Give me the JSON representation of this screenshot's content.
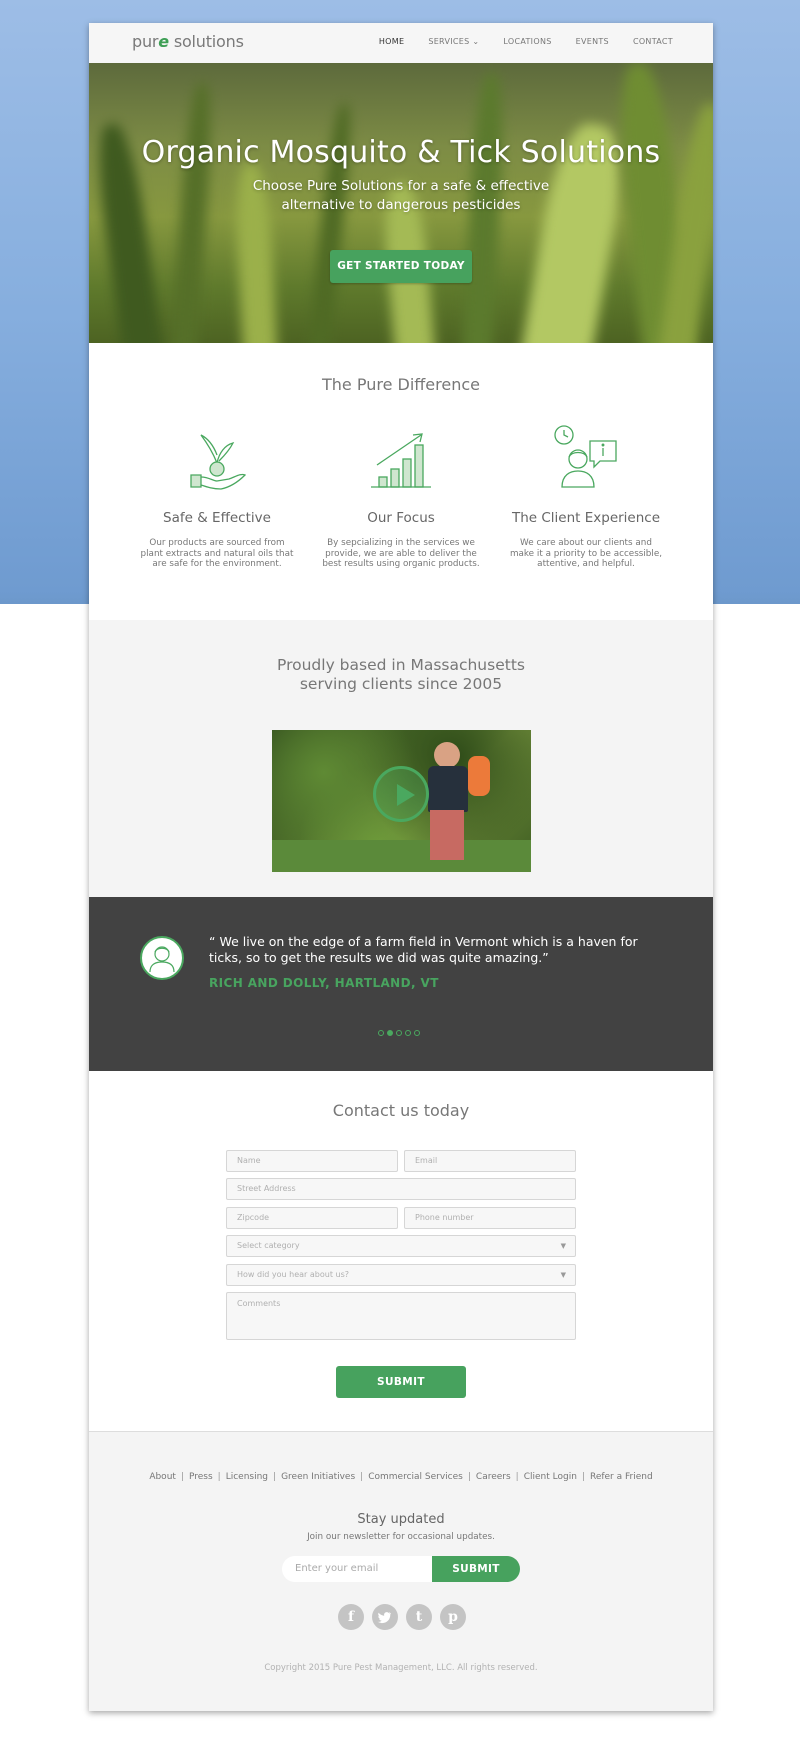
{
  "nav": {
    "logo_main": "pur",
    "logo_accent": "e",
    "logo_rest": " solutions",
    "links": [
      "HOME",
      "SERVICES",
      "LOCATIONS",
      "EVENTS",
      "CONTACT"
    ]
  },
  "hero": {
    "title": "Organic Mosquito & Tick Solutions",
    "subtitle_line1": "Choose Pure Solutions for a safe & effective",
    "subtitle_line2": "alternative to dangerous pesticides",
    "cta_label": "GET STARTED TODAY"
  },
  "difference": {
    "title": "The Pure Difference",
    "features": [
      {
        "icon": "plant-in-hand-icon",
        "title": "Safe & Effective",
        "text": "Our products are sourced from plant extracts and natural oils that are safe for the environment."
      },
      {
        "icon": "growth-chart-icon",
        "title": "Our Focus",
        "text": "By sepcializing in the services we provide, we are able to deliver the best results using organic products."
      },
      {
        "icon": "client-support-icon",
        "title": "The Client Experience",
        "text": "We care about our clients and make it a priority to be accessible, attentive, and helpful."
      }
    ]
  },
  "about": {
    "title_line1": "Proudly based in Massachusetts",
    "title_line2": "serving clients since 2005"
  },
  "testimonial": {
    "quote": "“ We live on the edge of a farm field in Vermont which is a haven for ticks, so to get the results we did was quite amazing.”",
    "author": "RICH AND DOLLY, HARTLAND, VT",
    "slide_count": 5,
    "active_slide": 2
  },
  "contact": {
    "title": "Contact us today",
    "name_placeholder": "Name",
    "email_placeholder": "Email",
    "street_placeholder": "Street Address",
    "zip_placeholder": "Zipcode",
    "phone_placeholder": "Phone number",
    "category_placeholder": "Select category",
    "hear_placeholder": "How did you hear about us?",
    "comments_placeholder": "Comments",
    "submit_label": "SUBMIT"
  },
  "footer": {
    "links": [
      "About",
      "Press",
      "Licensing",
      "Green Initiatives",
      "Commercial Services",
      "Careers",
      "Client Login",
      "Refer a Friend"
    ],
    "newsletter_title": "Stay updated",
    "newsletter_sub": "Join our newsletter for occasional updates.",
    "email_placeholder": "Enter your email",
    "newsletter_button": "SUBMIT",
    "socials": [
      "f",
      "t",
      "t",
      "p"
    ],
    "copyright": "Copyright 2015 Pure Pest Management, LLC.  All rights reserved."
  },
  "colors": {
    "accent": "#47a25e",
    "dark": "#424242",
    "background_blue": "#7aa4d6"
  }
}
